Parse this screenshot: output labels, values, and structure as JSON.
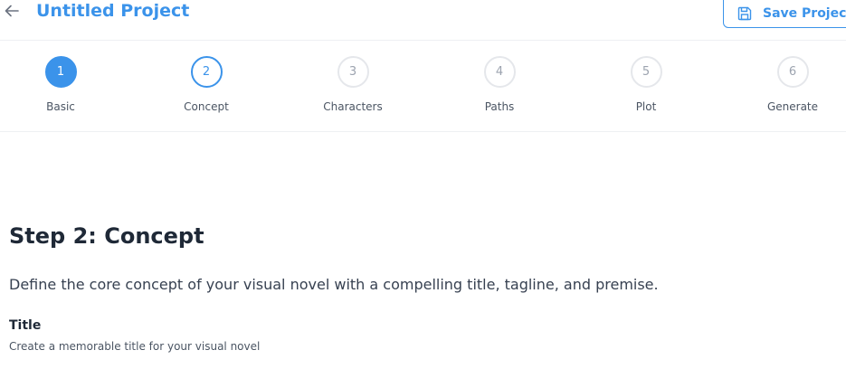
{
  "header": {
    "back_icon": "arrow-left-icon",
    "project_title": "Untitled Project",
    "save_label": "Save Project",
    "save_icon": "floppy-disk-icon",
    "accent_color": "#3b93ea"
  },
  "stepper": {
    "steps": [
      {
        "number": "1",
        "label": "Basic",
        "state": "completed"
      },
      {
        "number": "2",
        "label": "Concept",
        "state": "active"
      },
      {
        "number": "3",
        "label": "Characters",
        "state": "pending"
      },
      {
        "number": "4",
        "label": "Paths",
        "state": "pending"
      },
      {
        "number": "5",
        "label": "Plot",
        "state": "pending"
      },
      {
        "number": "6",
        "label": "Generate",
        "state": "pending"
      }
    ]
  },
  "main": {
    "heading": "Step 2: Concept",
    "description": "Define the core concept of your visual novel with a compelling title, tagline, and premise.",
    "title_field": {
      "label": "Title",
      "help": "Create a memorable title for your visual novel"
    }
  }
}
